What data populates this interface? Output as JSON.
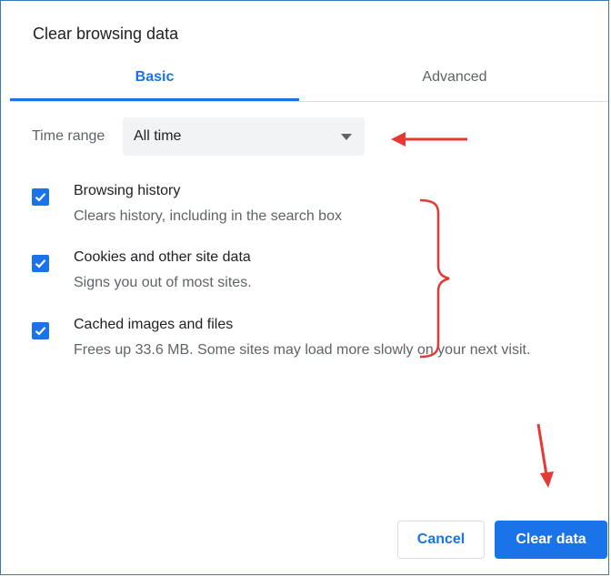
{
  "dialog": {
    "title": "Clear browsing data"
  },
  "tabs": [
    {
      "label": "Basic",
      "active": true
    },
    {
      "label": "Advanced",
      "active": false
    }
  ],
  "time_range": {
    "label": "Time range",
    "selected": "All time"
  },
  "items": [
    {
      "title": "Browsing history",
      "description": "Clears history, including in the search box",
      "checked": true
    },
    {
      "title": "Cookies and other site data",
      "description": "Signs you out of most sites.",
      "checked": true
    },
    {
      "title": "Cached images and files",
      "description": "Frees up 33.6 MB. Some sites may load more slowly on your next visit.",
      "checked": true
    }
  ],
  "buttons": {
    "cancel": "Cancel",
    "clear": "Clear data"
  },
  "colors": {
    "accent": "#1a73e8",
    "annotation": "#e53935"
  }
}
